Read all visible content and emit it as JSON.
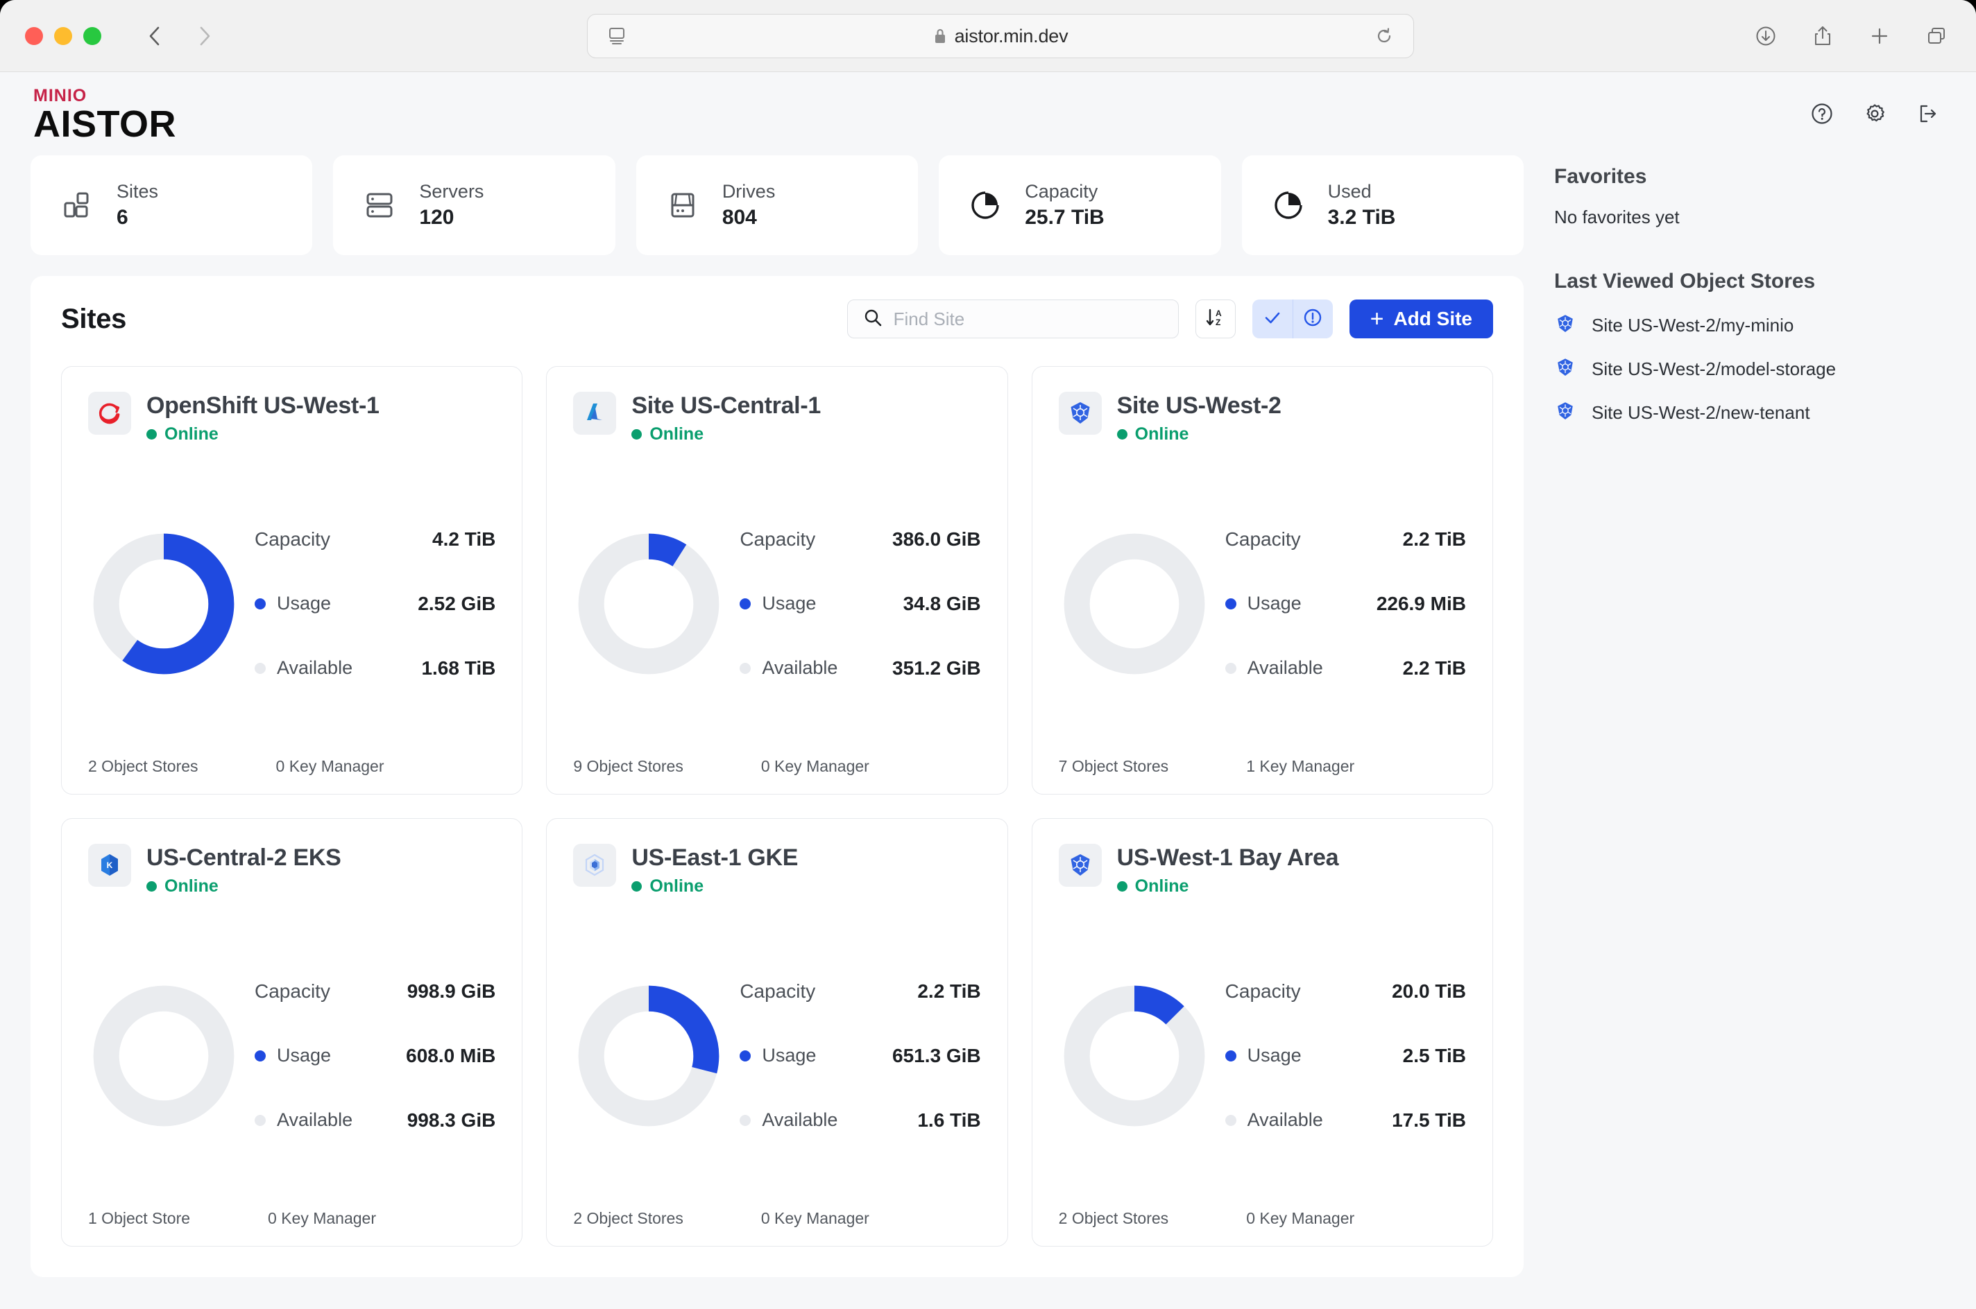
{
  "browser": {
    "url": "aistor.min.dev",
    "lock_icon": "lock-icon",
    "back_icon": "back-arrow-icon",
    "forward_icon": "forward-arrow-icon",
    "reader_icon": "reader-view-icon",
    "reload_icon": "reload-icon",
    "downloads_icon": "downloads-icon",
    "share_icon": "share-icon",
    "newtab_icon": "new-tab-icon",
    "tabs_icon": "tab-overview-icon"
  },
  "app": {
    "logo_top": "MINIO",
    "logo_bottom": "AISTOR",
    "brand_color": "#c62348",
    "accent_color": "#1f4ae0",
    "online_color": "#0a9e6e",
    "header_icons": [
      {
        "name": "help-icon",
        "label": "Help"
      },
      {
        "name": "settings-gear-icon",
        "label": "Settings"
      },
      {
        "name": "logout-icon",
        "label": "Log out"
      }
    ]
  },
  "stats": [
    {
      "label": "Sites",
      "value": "6",
      "icon": "sites-grid-icon"
    },
    {
      "label": "Servers",
      "value": "120",
      "icon": "servers-rack-icon"
    },
    {
      "label": "Drives",
      "value": "804",
      "icon": "drive-icon"
    },
    {
      "label": "Capacity",
      "value": "25.7 TiB",
      "icon": "pie-chart-icon"
    },
    {
      "label": "Used",
      "value": "3.2 TiB",
      "icon": "pie-chart-icon"
    }
  ],
  "sites_panel": {
    "title": "Sites",
    "search": {
      "value": "",
      "placeholder": "Find Site",
      "icon": "search-icon"
    },
    "sort_button": {
      "icon": "sort-az-icon",
      "label": "Sort A-Z"
    },
    "filter_ok": {
      "icon": "check-icon",
      "active": true
    },
    "filter_alert": {
      "icon": "alert-circle-icon",
      "active": true
    },
    "add_button": {
      "plus": "+",
      "label": "Add Site"
    }
  },
  "sites": [
    {
      "name": "OpenShift US-West-1",
      "status": "Online",
      "logo": "openshift-icon",
      "capacity_label": "Capacity",
      "capacity_value": "4.2 TiB",
      "usage_label": "Usage",
      "usage_value": "2.52 GiB",
      "available_label": "Available",
      "available_value": "1.68 TiB",
      "object_stores": "2 Object Stores",
      "key_manager": "0 Key Manager",
      "usage_percent": 60
    },
    {
      "name": "Site US-Central-1",
      "status": "Online",
      "logo": "azure-icon",
      "capacity_label": "Capacity",
      "capacity_value": "386.0 GiB",
      "usage_label": "Usage",
      "usage_value": "34.8 GiB",
      "available_label": "Available",
      "available_value": "351.2 GiB",
      "object_stores": "9 Object Stores",
      "key_manager": "0 Key Manager",
      "usage_percent": 9
    },
    {
      "name": "Site US-West-2",
      "status": "Online",
      "logo": "kubernetes-icon",
      "capacity_label": "Capacity",
      "capacity_value": "2.2 TiB",
      "usage_label": "Usage",
      "usage_value": "226.9 MiB",
      "available_label": "Available",
      "available_value": "2.2 TiB",
      "object_stores": "7 Object Stores",
      "key_manager": "1 Key Manager",
      "usage_percent": 0
    },
    {
      "name": "US-Central-2 EKS",
      "status": "Online",
      "logo": "eks-icon",
      "capacity_label": "Capacity",
      "capacity_value": "998.9 GiB",
      "usage_label": "Usage",
      "usage_value": "608.0 MiB",
      "available_label": "Available",
      "available_value": "998.3 GiB",
      "object_stores": "1 Object Store",
      "key_manager": "0 Key Manager",
      "usage_percent": 0
    },
    {
      "name": "US-East-1 GKE",
      "status": "Online",
      "logo": "gke-icon",
      "capacity_label": "Capacity",
      "capacity_value": "2.2 TiB",
      "usage_label": "Usage",
      "usage_value": "651.3 GiB",
      "available_label": "Available",
      "available_value": "1.6 TiB",
      "object_stores": "2 Object Stores",
      "key_manager": "0 Key Manager",
      "usage_percent": 29
    },
    {
      "name": "US-West-1 Bay Area",
      "status": "Online",
      "logo": "kubernetes-icon",
      "capacity_label": "Capacity",
      "capacity_value": "20.0 TiB",
      "usage_label": "Usage",
      "usage_value": "2.5 TiB",
      "available_label": "Available",
      "available_value": "17.5 TiB",
      "object_stores": "2 Object Stores",
      "key_manager": "0 Key Manager",
      "usage_percent": 12.5
    }
  ],
  "sidebar": {
    "favorites_title": "Favorites",
    "favorites_empty": "No favorites yet",
    "last_viewed_title": "Last Viewed Object Stores",
    "last_viewed": [
      {
        "label": "Site US-West-2/my-minio",
        "icon": "kubernetes-icon"
      },
      {
        "label": "Site US-West-2/model-storage",
        "icon": "kubernetes-icon"
      },
      {
        "label": "Site US-West-2/new-tenant",
        "icon": "kubernetes-icon"
      }
    ]
  },
  "chart_data": [
    {
      "type": "pie",
      "title": "OpenShift US-West-1 capacity",
      "labels": [
        "Usage",
        "Available"
      ],
      "values": [
        2.52,
        1680
      ],
      "display": [
        "2.52 GiB",
        "1.68 TiB"
      ],
      "arc_percent": 60,
      "colors": [
        "#1f4ae0",
        "#e8eaee"
      ]
    },
    {
      "type": "pie",
      "title": "Site US-Central-1 capacity",
      "labels": [
        "Usage",
        "Available"
      ],
      "values": [
        34.8,
        351.2
      ],
      "display": [
        "34.8 GiB",
        "351.2 GiB"
      ],
      "arc_percent": 9,
      "colors": [
        "#1f4ae0",
        "#e8eaee"
      ]
    },
    {
      "type": "pie",
      "title": "Site US-West-2 capacity",
      "labels": [
        "Usage",
        "Available"
      ],
      "values": [
        0.2216,
        2252.8
      ],
      "display": [
        "226.9 MiB",
        "2.2 TiB"
      ],
      "arc_percent": 0,
      "colors": [
        "#1f4ae0",
        "#e8eaee"
      ]
    },
    {
      "type": "pie",
      "title": "US-Central-2 EKS capacity",
      "labels": [
        "Usage",
        "Available"
      ],
      "values": [
        0.594,
        998.3
      ],
      "display": [
        "608.0 MiB",
        "998.3 GiB"
      ],
      "arc_percent": 0,
      "colors": [
        "#1f4ae0",
        "#e8eaee"
      ]
    },
    {
      "type": "pie",
      "title": "US-East-1 GKE capacity",
      "labels": [
        "Usage",
        "Available"
      ],
      "values": [
        651.3,
        1638.4
      ],
      "display": [
        "651.3 GiB",
        "1.6 TiB"
      ],
      "arc_percent": 29,
      "colors": [
        "#1f4ae0",
        "#e8eaee"
      ]
    },
    {
      "type": "pie",
      "title": "US-West-1 Bay Area capacity",
      "labels": [
        "Usage",
        "Available"
      ],
      "values": [
        2.5,
        17.5
      ],
      "display": [
        "2.5 TiB",
        "17.5 TiB"
      ],
      "arc_percent": 12.5,
      "colors": [
        "#1f4ae0",
        "#e8eaee"
      ]
    }
  ]
}
